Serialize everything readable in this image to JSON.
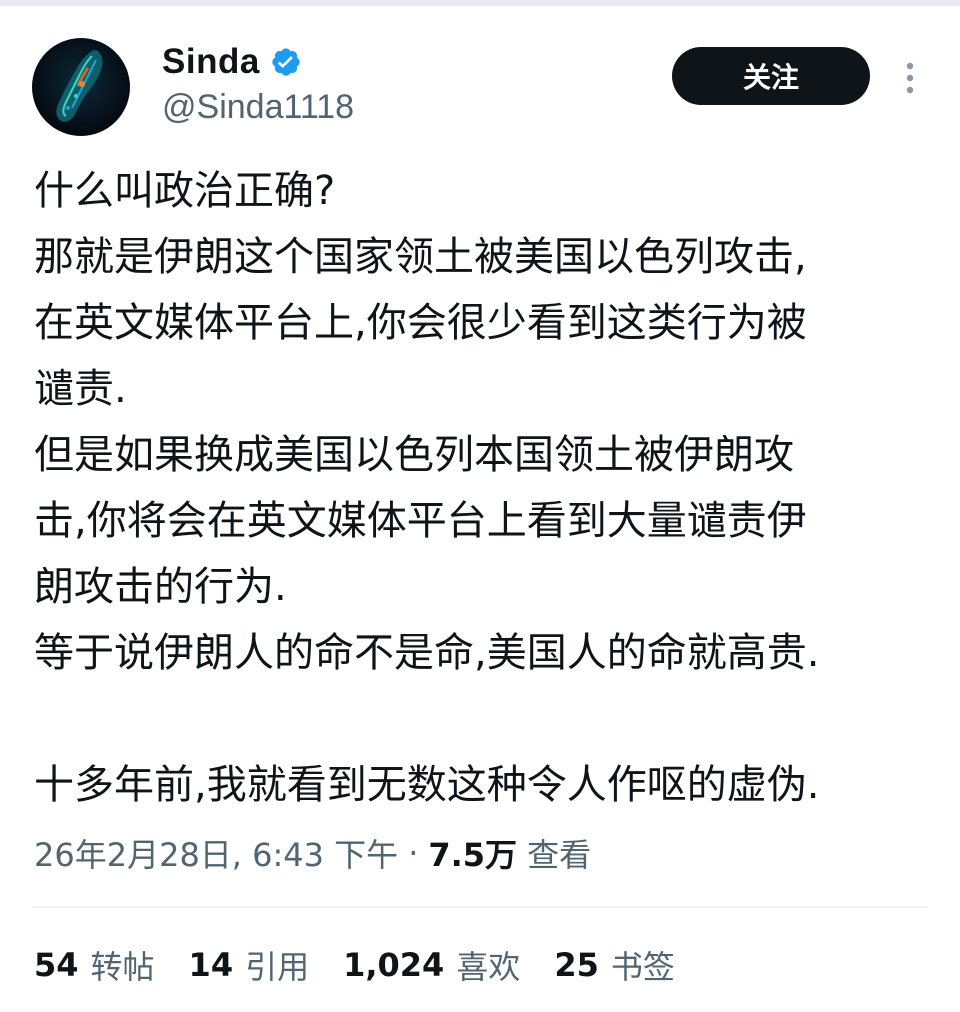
{
  "author": {
    "display_name": "Sinda",
    "handle": "@Sinda1118",
    "verified": true,
    "verified_color": "#1d9bf0"
  },
  "follow_button": {
    "label": "关注"
  },
  "tweet": {
    "text": "什么叫政治正确?\n那就是伊朗这个国家领土被美国以色列攻击,\n在英文媒体平台上,你会很少看到这类行为被\n谴责.\n但是如果换成美国以色列本国领土被伊朗攻\n击,你将会在英文媒体平台上看到大量谴责伊\n朗攻击的行为.\n等于说伊朗人的命不是命,美国人的命就高贵.\n\n十多年前,我就看到无数这种令人作呕的虚伪."
  },
  "meta": {
    "timestamp": "26年2月28日, 6:43 下午",
    "separator": "·",
    "views_count": "7.5万",
    "views_label": "查看"
  },
  "stats": [
    {
      "count": "54",
      "label": "转帖"
    },
    {
      "count": "14",
      "label": "引用"
    },
    {
      "count": "1,024",
      "label": "喜欢"
    },
    {
      "count": "25",
      "label": "书签"
    }
  ],
  "icons": {
    "verified": "verified-badge-icon",
    "more": "more-vertical-icon"
  }
}
